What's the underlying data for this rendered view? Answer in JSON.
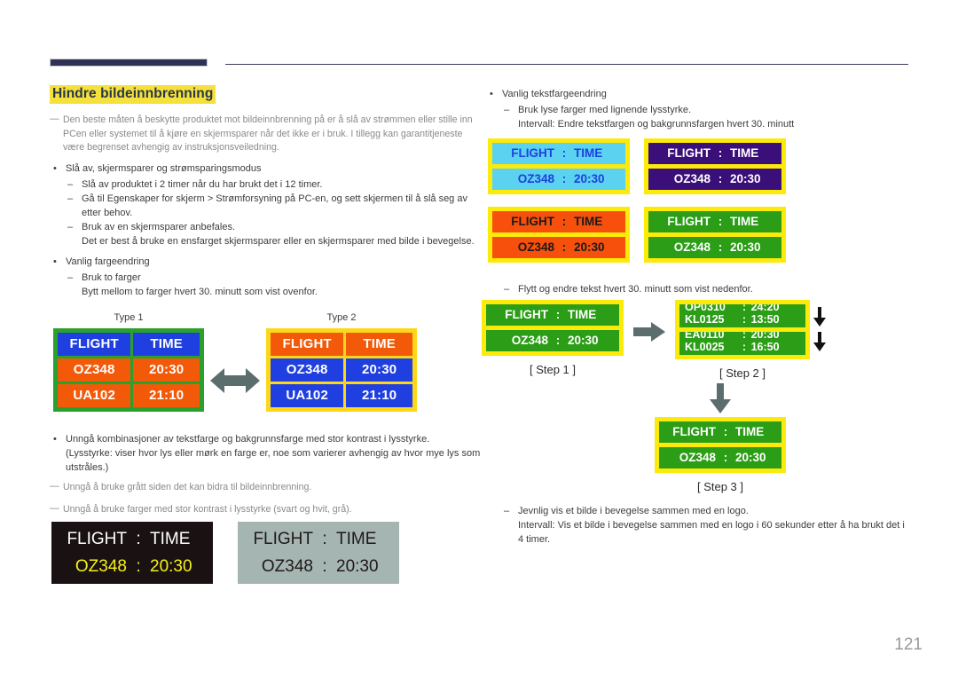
{
  "document": {
    "title": "Hindre bildeinnbrenning",
    "page_number": "121"
  },
  "left_column": {
    "intro_note": "Den beste måten å beskytte produktet mot bildeinnbrenning på er å slå av strømmen eller stille inn PCen eller systemet til å kjøre en skjermsparer når det ikke er i bruk. I tillegg kan garantitjeneste være begrenset avhengig av instruksjonsveiledning.",
    "bullet1": {
      "label": "Slå av, skjermsparer og strømsparingsmodus",
      "sub": [
        {
          "text": "Slå av produktet i 2 timer når du har brukt det i 12 timer.",
          "cont": ""
        },
        {
          "text": "Gå til Egenskaper for skjerm > Strømforsyning på PC-en, og sett skjermen til å slå seg av etter behov.",
          "cont": ""
        },
        {
          "text": "Bruk av en skjermsparer anbefales.",
          "cont": "Det er best å bruke en ensfarget skjermsparer eller en skjermsparer med bilde i bevegelse."
        }
      ]
    },
    "bullet2": {
      "label": "Vanlig fargeendring",
      "sub": [
        {
          "text": "Bruk to farger",
          "cont": "Bytt mellom to farger hvert 30. minutt som vist ovenfor."
        }
      ]
    },
    "bullet3": {
      "label": "Unngå kombinasjoner av tekstfarge og bakgrunnsfarge med stor kontrast i lysstyrke.",
      "cont": "(Lysstyrke: viser hvor lys eller mørk en farge er, noe som varierer avhengig av hvor mye lys som utstråles.)"
    },
    "note2": "Unngå å bruke grått siden det kan bidra til bildeinnbrenning.",
    "note3": "Unngå å bruke farger med stor kontrast i lysstyrke (svart og hvit, grå)."
  },
  "type_boards": {
    "type1_label": "Type 1",
    "type2_label": "Type 2",
    "arrow_icon": "double-arrow-horizontal",
    "headers": [
      "FLIGHT",
      "TIME"
    ],
    "rows": [
      [
        "OZ348",
        "20:30"
      ],
      [
        "UA102",
        "21:10"
      ]
    ],
    "type1_colors": {
      "border": "#2ca02c",
      "header_bg": "#1f3fe0",
      "row_bg": "#f25a0a",
      "text": "#ffffff"
    },
    "type2_colors": {
      "border": "#fcd71a",
      "header_bg": "#f25a0a",
      "row_bg": "#1f3fe0",
      "text": "#ffffff"
    }
  },
  "contrast_boards": [
    {
      "name": "dark-board",
      "bg": "#1a1212",
      "header": {
        "a": "FLIGHT",
        "colon": ":",
        "b": "TIME",
        "color": "#ffffff"
      },
      "row": {
        "a": "OZ348",
        "colon": ":",
        "b": "20:30",
        "color": "#f5f01a"
      }
    },
    {
      "name": "gray-board",
      "bg": "#a4b5b2",
      "header": {
        "a": "FLIGHT",
        "colon": ":",
        "b": "TIME",
        "color": "#201818"
      },
      "row": {
        "a": "OZ348",
        "colon": ":",
        "b": "20:30",
        "color": "#201818"
      }
    }
  ],
  "right_column": {
    "bullet1": {
      "label": "Vanlig tekstfargeendring",
      "sub": [
        {
          "text": "Bruk lyse farger med lignende lysstyrke.",
          "cont": "Intervall: Endre tekstfargen og bakgrunnsfargen hvert 30. minutt"
        }
      ]
    },
    "move_note": "Flytt og endre tekst hvert 30. minutt som vist nedenfor.",
    "bottom_sub": {
      "text": "Jevnlig vis et bilde i bevegelse sammen med en logo.",
      "cont": "Intervall: Vis et bilde i bevegelse sammen med en logo i 60 sekunder etter å ha brukt det i 4 timer."
    },
    "color_boards": [
      {
        "name": "cyan-board",
        "frame": "#fcea0a",
        "panel": "#5ad2f0",
        "text": "#1f3fe0",
        "header": {
          "a": "FLIGHT",
          "colon": ":",
          "b": "TIME"
        },
        "row": {
          "a": "OZ348",
          "colon": ":",
          "b": "20:30"
        }
      },
      {
        "name": "purple-board",
        "frame": "#fcea0a",
        "panel": "#3b0f7a",
        "text": "#ffffff",
        "header": {
          "a": "FLIGHT",
          "colon": ":",
          "b": "TIME"
        },
        "row": {
          "a": "OZ348",
          "colon": ":",
          "b": "20:30"
        }
      },
      {
        "name": "orange-board",
        "frame": "#fcea0a",
        "panel": "#f6500c",
        "text": "#1a1a1a",
        "header": {
          "a": "FLIGHT",
          "colon": ":",
          "b": "TIME"
        },
        "row": {
          "a": "OZ348",
          "colon": ":",
          "b": "20:30"
        }
      },
      {
        "name": "green-board",
        "frame": "#fcea0a",
        "panel": "#2b9d16",
        "text": "#ffffff",
        "header": {
          "a": "FLIGHT",
          "colon": ":",
          "b": "TIME"
        },
        "row": {
          "a": "OZ348",
          "colon": ":",
          "b": "20:30"
        }
      }
    ],
    "steps": {
      "step1": {
        "label": "[ Step 1 ]",
        "frame": "#fcea0a",
        "panel": "#2b9d16",
        "text": "#ffffff",
        "header": {
          "a": "FLIGHT",
          "colon": ":",
          "b": "TIME"
        },
        "row": {
          "a": "OZ348",
          "colon": ":",
          "b": "20:30"
        }
      },
      "step2": {
        "label": "[ Step 2 ]",
        "frame": "#fcea0a",
        "panel": "#2b9d16",
        "text": "#ffffff",
        "panel_a_lines": [
          {
            "a": "OP0310",
            "colon": ":",
            "b": "24:20"
          },
          {
            "a": "KL0125",
            "colon": ":",
            "b": "13:50"
          }
        ],
        "panel_b_lines": [
          {
            "a": "EA0110",
            "colon": ":",
            "b": "20:30"
          },
          {
            "a": "KL0025",
            "colon": ":",
            "b": "16:50"
          }
        ],
        "scroll_icons": [
          "arrow-down-icon",
          "arrow-down-icon"
        ]
      },
      "step3": {
        "label": "[ Step 3 ]",
        "frame": "#fcea0a",
        "panel": "#2b9d16",
        "text": "#ffffff",
        "header": {
          "a": "FLIGHT",
          "colon": ":",
          "b": "TIME"
        },
        "row": {
          "a": "OZ348",
          "colon": ":",
          "b": "20:30"
        }
      },
      "arrow_right_icon": "arrow-right-icon",
      "arrow_down_icon": "arrow-down-thick-icon"
    }
  }
}
